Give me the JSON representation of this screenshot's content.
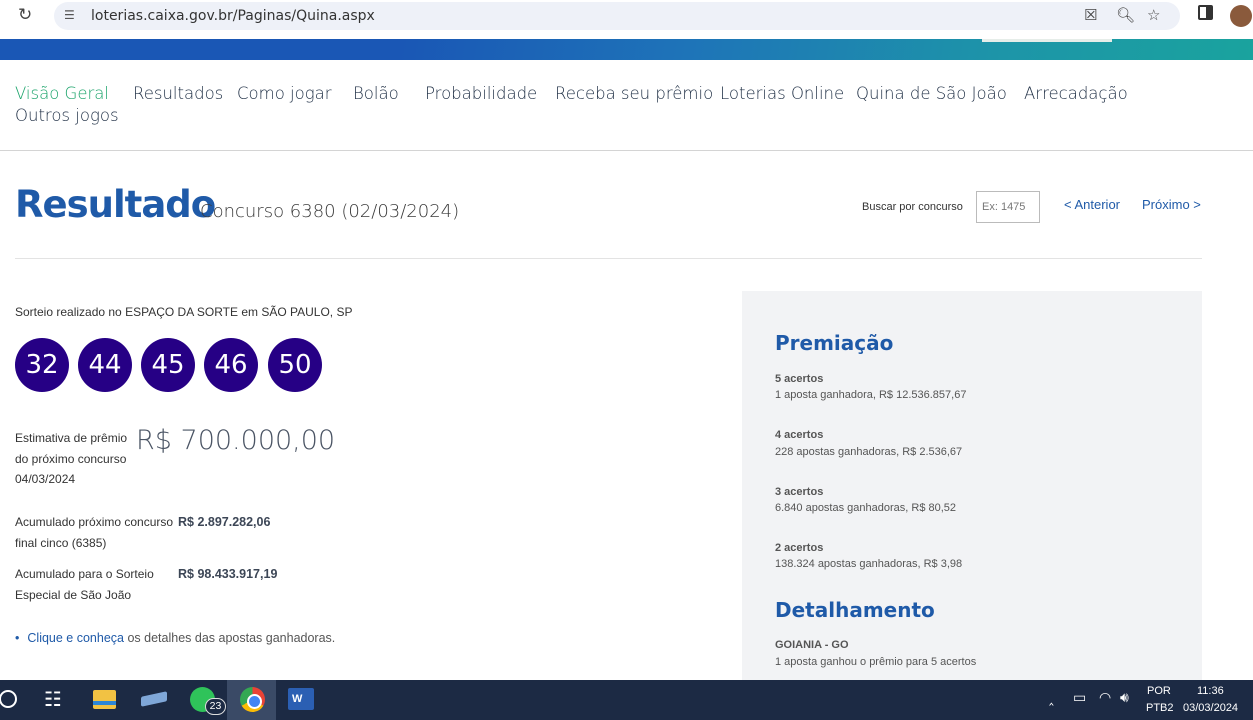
{
  "browser": {
    "url": "loterias.caixa.gov.br/Paginas/Quina.aspx",
    "icons": [
      "reload-icon",
      "site-settings-icon",
      "reader-mode-off-icon",
      "zoom-icon",
      "bookmark-star-icon",
      "side-panel-icon",
      "profile-avatar"
    ]
  },
  "nav": {
    "items": [
      "Visão Geral",
      "Resultados",
      "Como jogar",
      "Bolão",
      "Probabilidade",
      "Receba seu prêmio",
      "Loterias Online",
      "Quina de São João",
      "Arrecadação",
      "Outros jogos"
    ],
    "active_color": "#1aa36a"
  },
  "result": {
    "title": "Resultado",
    "concurso": "Concurso 6380 (02/03/2024)",
    "search_label": "Buscar por concurso",
    "search_placeholder": "Ex: 1475",
    "prev": "< Anterior",
    "next": "Próximo >"
  },
  "draw": {
    "location": "Sorteio realizado no ESPAÇO DA SORTE em SÃO PAULO, SP",
    "numbers": [
      "32",
      "44",
      "45",
      "46",
      "50"
    ],
    "ball_color": "#260085"
  },
  "estimate": {
    "label_line1": "Estimativa de prêmio",
    "label_line2": "do próximo concurso",
    "date": "04/03/2024",
    "value": "R$ 700.000,00"
  },
  "accumulated": [
    {
      "label_line1": "Acumulado próximo concurso",
      "label_line2": "final cinco (6385)",
      "value": "R$ 2.897.282,06"
    },
    {
      "label_line1": "Acumulado para o Sorteio",
      "label_line2": "Especial de São João",
      "value": "R$ 98.433.917,19"
    }
  ],
  "details_link": {
    "link_text": "Clique e conheça",
    "rest_text": " os detalhes das apostas ganhadoras."
  },
  "premiacao": {
    "title": "Premiação",
    "tiers": [
      {
        "hits": "5 acertos",
        "desc": "1 aposta ganhadora, R$ 12.536.857,67"
      },
      {
        "hits": "4 acertos",
        "desc": "228 apostas ganhadoras, R$ 2.536,67"
      },
      {
        "hits": "3 acertos",
        "desc": "6.840 apostas ganhadoras, R$ 80,52"
      },
      {
        "hits": "2 acertos",
        "desc": "138.324 apostas ganhadoras, R$ 3,98"
      }
    ]
  },
  "detalhamento": {
    "title": "Detalhamento",
    "city": "GOIANIA - GO",
    "desc": "1 aposta ganhou o prêmio para 5 acertos"
  },
  "taskbar": {
    "whatsapp_badge": "23",
    "language": "POR",
    "keyboard": "PTB2",
    "time": "11:36",
    "date": "03/03/2024"
  },
  "colors": {
    "brand_blue": "#1f5aa8",
    "panel_bg": "#f2f3f5",
    "taskbar_bg": "#1c2a44"
  }
}
